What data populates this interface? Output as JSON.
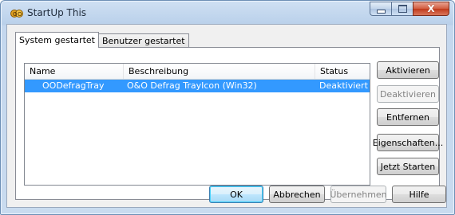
{
  "window": {
    "title": "StartUp This",
    "caption": {
      "minimize": "–",
      "maximize": "□",
      "close": "X"
    }
  },
  "tabs": [
    {
      "label": "System gestartet",
      "active": true
    },
    {
      "label": "Benutzer gestartet",
      "active": false
    }
  ],
  "list": {
    "columns": [
      "Name",
      "Beschreibung",
      "Status"
    ],
    "rows": [
      {
        "name": "OODefragTray",
        "description": "O&O Defrag TrayIcon (Win32)",
        "status": "Deaktiviert",
        "selected": true
      }
    ]
  },
  "side_buttons": {
    "activate": "Aktivieren",
    "deactivate": "Deaktivieren",
    "remove": "Entfernen",
    "properties": "Eigenschaften...",
    "start_now": "Jetzt Starten"
  },
  "bottom_buttons": {
    "ok": "OK",
    "cancel": "Abbrechen",
    "apply": "Übernehmen",
    "help": "Hilfe"
  },
  "colors": {
    "selection": "#3399ff",
    "title_text": "#1e2a3a",
    "close_button": "#c0391b"
  }
}
